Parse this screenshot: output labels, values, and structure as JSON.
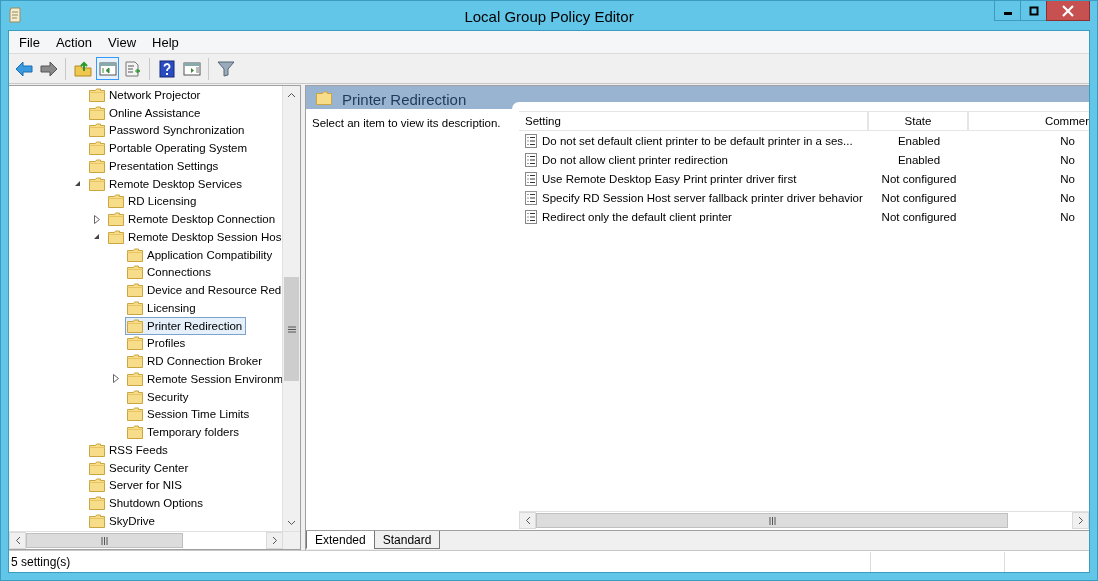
{
  "window": {
    "title": "Local Group Policy Editor"
  },
  "menu": [
    "File",
    "Action",
    "View",
    "Help"
  ],
  "toolbar": [
    {
      "kind": "back",
      "pressed": false
    },
    {
      "kind": "forward",
      "pressed": false
    },
    {
      "kind": "sep"
    },
    {
      "kind": "up",
      "pressed": false
    },
    {
      "kind": "tree",
      "pressed": true
    },
    {
      "kind": "export",
      "pressed": false
    },
    {
      "kind": "sep"
    },
    {
      "kind": "help",
      "pressed": false
    },
    {
      "kind": "pane",
      "pressed": false
    },
    {
      "kind": "sep"
    },
    {
      "kind": "filter",
      "pressed": false
    }
  ],
  "tree": [
    {
      "label": "Network Projector",
      "selected": false
    },
    {
      "label": "Online Assistance",
      "selected": false
    },
    {
      "label": "Password Synchronization",
      "selected": false
    },
    {
      "label": "Portable Operating System",
      "selected": false
    },
    {
      "label": "Presentation Settings",
      "selected": false
    },
    {
      "label": "Remote Desktop Services",
      "selected": false,
      "expanded": true,
      "children": [
        {
          "label": "RD Licensing",
          "selected": false
        },
        {
          "label": "Remote Desktop Connection",
          "selected": false,
          "expanded": false
        },
        {
          "label": "Remote Desktop Session Hos",
          "selected": false,
          "expanded": true,
          "children": [
            {
              "label": "Application Compatibility",
              "selected": false
            },
            {
              "label": "Connections",
              "selected": false
            },
            {
              "label": "Device and Resource Red",
              "selected": false
            },
            {
              "label": "Licensing",
              "selected": false
            },
            {
              "label": "Printer Redirection",
              "selected": true
            },
            {
              "label": "Profiles",
              "selected": false
            },
            {
              "label": "RD Connection Broker",
              "selected": false
            },
            {
              "label": "Remote Session Environm",
              "selected": false,
              "expanded": false
            },
            {
              "label": "Security",
              "selected": false
            },
            {
              "label": "Session Time Limits",
              "selected": false
            },
            {
              "label": "Temporary folders",
              "selected": false
            }
          ]
        }
      ]
    },
    {
      "label": "RSS Feeds",
      "selected": false
    },
    {
      "label": "Security Center",
      "selected": false
    },
    {
      "label": "Server for NIS",
      "selected": false
    },
    {
      "label": "Shutdown Options",
      "selected": false
    },
    {
      "label": "SkyDrive",
      "selected": false
    }
  ],
  "pane": {
    "title": "Printer Redirection",
    "description": "Select an item to view its description."
  },
  "table": {
    "columns": [
      "Setting",
      "State",
      "Commer"
    ],
    "rows": [
      {
        "setting": "Do not set default client printer to be default printer in a ses...",
        "state": "Enabled",
        "comment": "No",
        "selected": false
      },
      {
        "setting": "Do not allow client printer redirection",
        "state": "Enabled",
        "comment": "No",
        "selected": false
      },
      {
        "setting": "Use Remote Desktop Easy Print printer driver first",
        "state": "Not configured",
        "comment": "No",
        "selected": false
      },
      {
        "setting": "Specify RD Session Host server fallback printer driver behavior",
        "state": "Not configured",
        "comment": "No",
        "selected": false
      },
      {
        "setting": "Redirect only the default client printer",
        "state": "Not configured",
        "comment": "No",
        "selected": false
      }
    ]
  },
  "view_tabs": [
    {
      "label": "Extended",
      "selected": true
    },
    {
      "label": "Standard",
      "selected": false
    }
  ],
  "status_bar": {
    "text": "5 setting(s)"
  }
}
